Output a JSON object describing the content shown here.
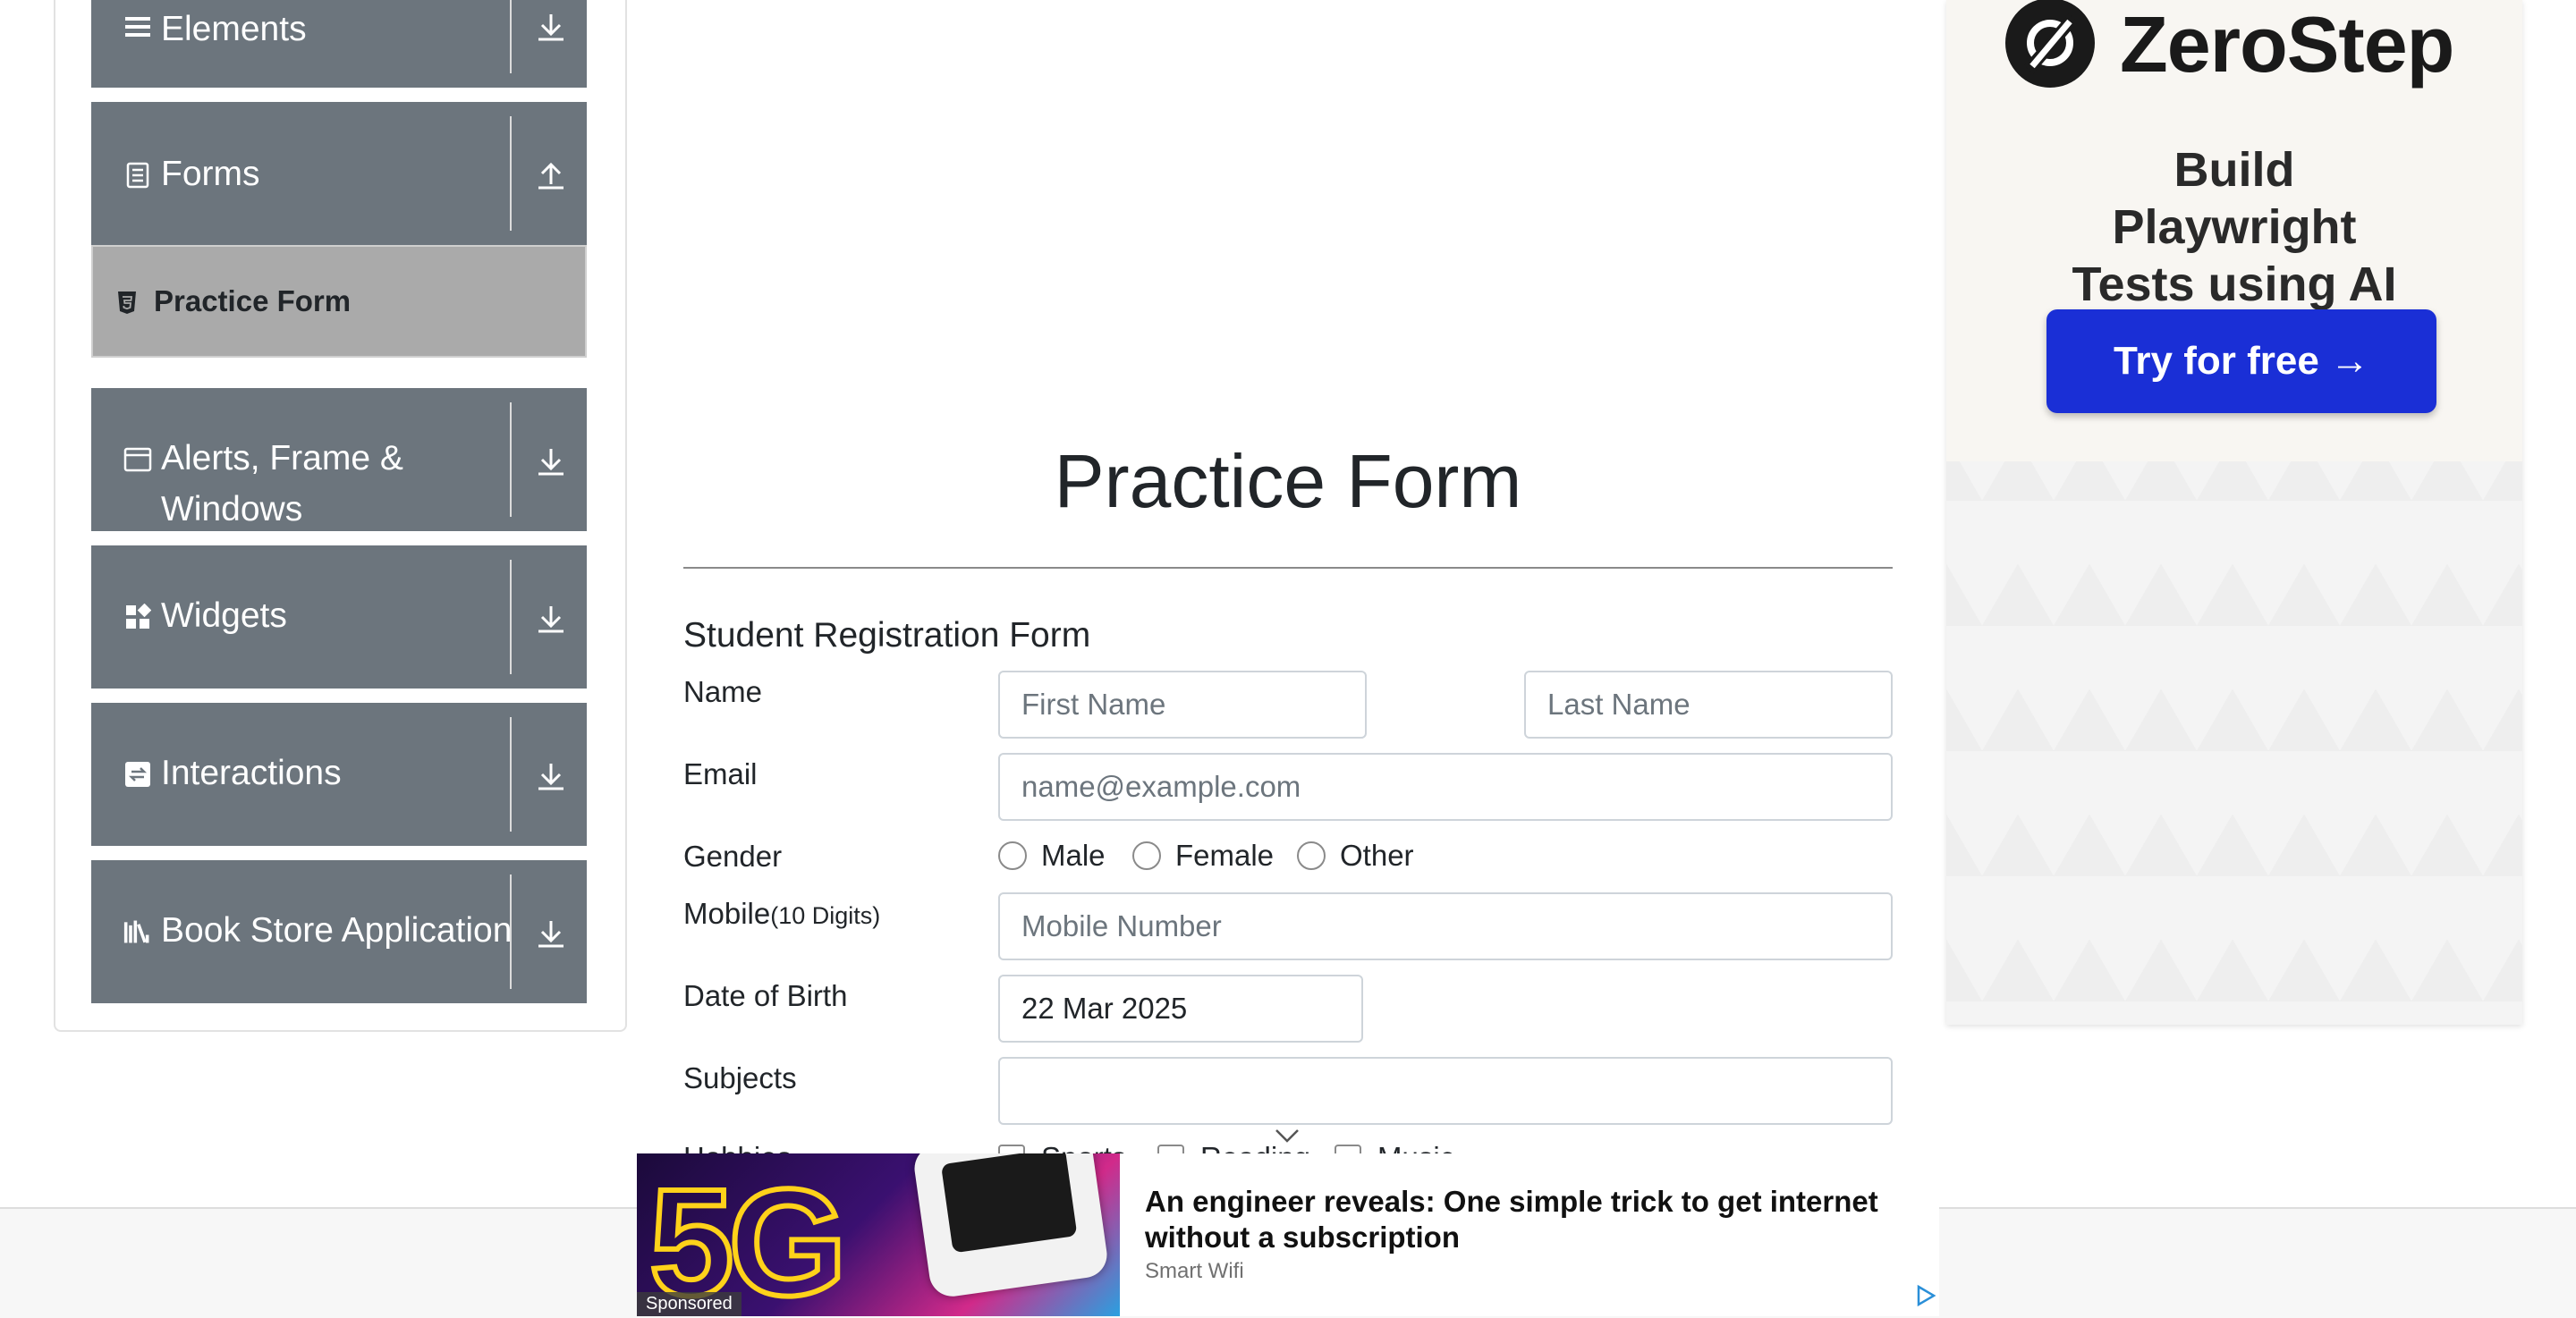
{
  "sidebar": {
    "groups": [
      {
        "label": "Elements",
        "icon": "menu-icon",
        "arrow": "download-arrow-icon"
      },
      {
        "label": "Forms",
        "icon": "document-icon",
        "arrow": "upload-arrow-icon"
      },
      {
        "label": "Alerts, Frame & Windows",
        "icon": "window-icon",
        "arrow": "download-arrow-icon"
      },
      {
        "label": "Widgets",
        "icon": "widgets-icon",
        "arrow": "download-arrow-icon"
      },
      {
        "label": "Interactions",
        "icon": "interactions-icon",
        "arrow": "download-arrow-icon"
      },
      {
        "label": "Book Store Application",
        "icon": "books-icon",
        "arrow": "download-arrow-icon"
      }
    ],
    "active_item": {
      "label": "Practice Form",
      "icon": "html5-icon"
    }
  },
  "main": {
    "page_title": "Practice Form",
    "form_heading": "Student Registration Form",
    "name": {
      "label": "Name",
      "first_placeholder": "First Name",
      "last_placeholder": "Last Name"
    },
    "email": {
      "label": "Email",
      "placeholder": "name@example.com"
    },
    "gender": {
      "label": "Gender",
      "options": [
        "Male",
        "Female",
        "Other"
      ]
    },
    "mobile": {
      "label": "Mobile",
      "hint": "(10 Digits)",
      "placeholder": "Mobile Number"
    },
    "dob": {
      "label": "Date of Birth",
      "value": "22 Mar 2025"
    },
    "subjects": {
      "label": "Subjects",
      "value": ""
    },
    "hobbies": {
      "label": "Hobbies",
      "options": [
        "Sports",
        "Reading",
        "Music"
      ]
    }
  },
  "ad_right": {
    "brand": "ZeroStep",
    "tagline": "Build Playwright Tests using AI",
    "cta": "Try for free →",
    "brand_color": "#1a2fd6"
  },
  "ad_bottom": {
    "image_text": "5G",
    "sponsored": "Sponsored",
    "headline": "An engineer reveals: One simple trick to get internet without a subscription",
    "source": "Smart Wifi"
  },
  "colors": {
    "sidebar_group_bg": "#6c757d",
    "sidebar_active_bg": "#aaaaaa",
    "input_border": "#ced4da"
  }
}
